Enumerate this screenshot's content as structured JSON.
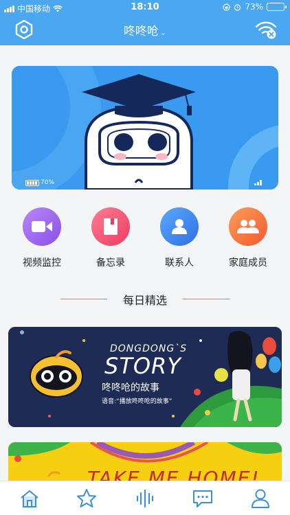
{
  "status_bar": {
    "carrier": "中国移动",
    "time": "18:10",
    "battery_percent": "73%"
  },
  "header": {
    "title": "咚咚呛",
    "chevron": "⌄",
    "left_icon": "hex-settings-icon",
    "right_icon": "wifi-disconnected-icon"
  },
  "banner": {
    "battery_percent": "70%",
    "background_color": "#3a9af0"
  },
  "actions": [
    {
      "label": "视频监控",
      "icon": "video-camera-icon",
      "color": "#a36bf2"
    },
    {
      "label": "备忘录",
      "icon": "notebook-icon",
      "color": "#f25a78"
    },
    {
      "label": "联系人",
      "icon": "contact-person-icon",
      "color": "#3f8cf2"
    },
    {
      "label": "家庭成员",
      "icon": "family-members-icon",
      "color": "#f77a42"
    }
  ],
  "section": {
    "title": "每日精选"
  },
  "story_card": {
    "subtitle_en": "DONGDONG`S",
    "title_en": "STORY",
    "title_cn": "咚咚呛的故事",
    "hint": "语音:“播放咚咚呛的故事”"
  },
  "home_card": {
    "text": "TAKE ME HOME!"
  },
  "tabbar": {
    "items": [
      "home-icon",
      "star-icon",
      "voice-wave-icon",
      "message-icon",
      "profile-icon"
    ],
    "active": 0,
    "color": "#3a8fd9"
  }
}
